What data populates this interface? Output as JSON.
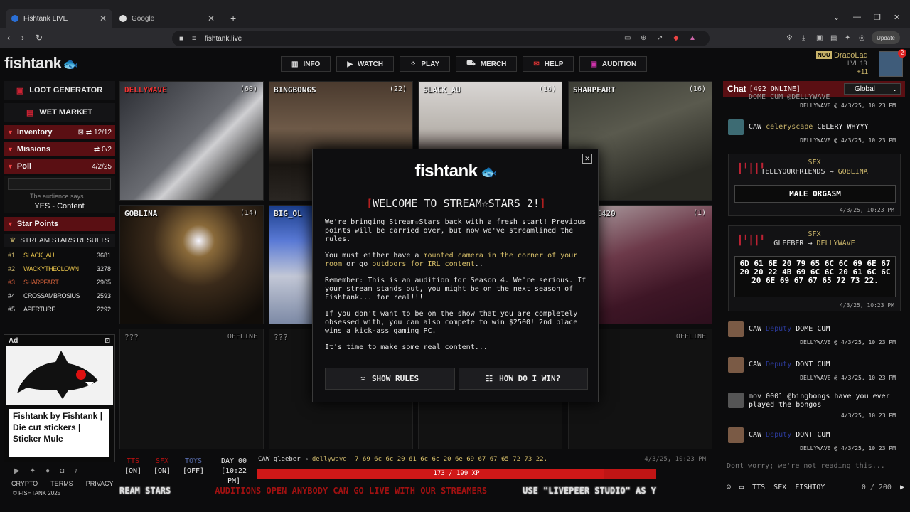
{
  "browser": {
    "tabs": [
      {
        "label": "Fishtank LIVE",
        "active": true
      },
      {
        "label": "Google",
        "active": false
      }
    ],
    "url": "fishtank.live",
    "update_label": "Update"
  },
  "site": {
    "logo": "fishtank",
    "nav": [
      {
        "label": "INFO",
        "icon": "info-icon"
      },
      {
        "label": "WATCH",
        "icon": "watch-icon"
      },
      {
        "label": "PLAY",
        "icon": "dice-icon"
      },
      {
        "label": "MERCH",
        "icon": "merch-icon"
      },
      {
        "label": "HELP",
        "icon": "help-icon"
      },
      {
        "label": "AUDITION",
        "icon": "audition-icon"
      }
    ],
    "user": {
      "badge": "NOU",
      "name": "DracoLad",
      "level": "LVL 13",
      "coins": "+11",
      "notifications": "2"
    }
  },
  "sidebar": {
    "loot_label": "LOOT GENERATOR",
    "market_label": "WET MARKET",
    "inventory": {
      "label": "Inventory",
      "count": "12/12"
    },
    "missions": {
      "label": "Missions",
      "count": "0/2"
    },
    "poll": {
      "label": "Poll",
      "date": "4/2/25",
      "question": "The audience says...",
      "answer": "YES - Content"
    },
    "star_points": {
      "label": "Star Points",
      "results_label": "STREAM STARS RESULTS",
      "rows": [
        {
          "rank": "#1",
          "name": "SLACK_AU",
          "points": "3681"
        },
        {
          "rank": "#2",
          "name": "WACKYTHECLOWN",
          "points": "3278"
        },
        {
          "rank": "#3",
          "name": "SHARPFART",
          "points": "2965"
        },
        {
          "rank": "#4",
          "name": "CROSSAMBROSIUS",
          "points": "2593"
        },
        {
          "rank": "#5",
          "name": "APERTURE",
          "points": "2292"
        }
      ]
    },
    "ad": {
      "label": "Ad",
      "text": "Fishtank by Fishtank | Die cut stickers | Sticker Mule"
    },
    "footer_links": [
      "CRYPTO",
      "TERMS",
      "PRIVACY"
    ],
    "copyright": "© FISHTANK 2025"
  },
  "cams": [
    {
      "name": "DELLYWAVE",
      "count": "(60)",
      "offline": false
    },
    {
      "name": "BINGBONGS",
      "count": "(22)",
      "offline": false
    },
    {
      "name": "SLACK_AU",
      "count": "(16)",
      "offline": false
    },
    {
      "name": "SHARPFART",
      "count": "(16)",
      "offline": false
    },
    {
      "name": "GOBLINA",
      "count": "(14)",
      "offline": false
    },
    {
      "name": "BIG_OL",
      "count": "",
      "offline": false
    },
    {
      "name": "",
      "count": "",
      "offline": false
    },
    {
      "name": "IEBABE420",
      "count": "(1)",
      "offline": false
    },
    {
      "name": "???",
      "count": "OFFLINE",
      "offline": true
    },
    {
      "name": "???",
      "count": "",
      "offline": true
    },
    {
      "name": "",
      "count": "",
      "offline": true
    },
    {
      "name": "",
      "count": "OFFLINE",
      "offline": true
    }
  ],
  "modal": {
    "logo": "fishtank",
    "title": "WELCOME TO STREAM☆STARS 2!",
    "p1": "We're bringing Stream☆Stars back with a fresh start! Previous points will be carried over, but now we've streamlined the rules.",
    "p2_a": "You must either have a ",
    "p2_hl1": "mounted camera in the corner of your room",
    "p2_b": " or go ",
    "p2_hl2": "outdoors for IRL content",
    "p2_c": "..",
    "p3": "Remember: This is an audition for Season 4. We're serious. If your stream stands out, you might be on the next season of Fishtank... for real!!!",
    "p4": "If you don't want to be on the show that you are completely obsessed with, you can also compete to win $2500! 2nd place wins a kick-ass gaming PC.",
    "p5": "It's time to make some real content...",
    "btn_rules": "SHOW RULES",
    "btn_win": "HOW DO I WIN?"
  },
  "bottom": {
    "toggles": [
      {
        "label": "TTS",
        "state": "[ON]",
        "color": "#b11"
      },
      {
        "label": "SFX",
        "state": "[ON]",
        "color": "#b11"
      },
      {
        "label": "TOYS",
        "state": "[OFF]",
        "color": "#5a6fb0"
      }
    ],
    "day": {
      "label": "DAY 00",
      "time": "[10:22 PM]"
    },
    "last_event": {
      "prefix": "CAW",
      "from": "gleeber",
      "to": "dellywave",
      "hex": "7 69 6c 6c 20 61 6c 6c 20 6e 69 67 67 65 72 73 22.",
      "time": "4/3/25, 10:23 PM"
    },
    "xp": {
      "label": "173 / 199 XP",
      "fraction": 0.869
    },
    "ticker_a": "REAM STARS",
    "ticker_b": "AUDITIONS OPEN ANYBODY CAN GO LIVE WITH OUR STREAMERS",
    "ticker_c": "USE \"LIVEPEER STUDIO\" AS Y"
  },
  "chat": {
    "title": "Chat",
    "online": "[492 ONLINE]",
    "channel": "Global",
    "top_partial": "DOME CUM @DELLYWAVE",
    "top_meta": "DELLYWAVE @ 4/3/25, 10:23 PM",
    "m1": {
      "prefix": "CAW",
      "user": "celeryscape",
      "text": "CELERY WHYYY",
      "meta": "DELLYWAVE @ 4/3/25, 10:23 PM"
    },
    "sfx1": {
      "label": "SFX",
      "from": "TELLYOURFRIENDS",
      "to": "GOBLINA",
      "box": "MALE ORGASM",
      "meta": "4/3/25, 10:23 PM"
    },
    "sfx2": {
      "label": "SFX",
      "from": "GLEEBER",
      "to": "DELLYWAVE",
      "box": "6D 61 6E 20 79 65 6C 6C 69 6E 67 20 20 22 4B 69 6C 6C 20 61 6C 6C 20 6E 69 67 67 65 72 73 22.",
      "meta": "4/3/25, 10:23 PM"
    },
    "m2": {
      "prefix": "CAW",
      "user": "Deputy",
      "text": "DOME CUM",
      "meta": "DELLYWAVE @ 4/3/25, 10:23 PM"
    },
    "m3": {
      "prefix": "CAW",
      "user": "Deputy",
      "text": "DONT CUM",
      "meta": "DELLYWAVE @ 4/3/25, 10:23 PM"
    },
    "m4": {
      "user": "mov_0001",
      "line1": "@bingbongs have you ever",
      "line2": "played the bongos",
      "meta": "4/3/25, 10:23 PM"
    },
    "m5": {
      "prefix": "CAW",
      "user": "Deputy",
      "text": "DONT CUM",
      "meta": "DELLYWAVE @ 4/3/25, 10:23 PM"
    },
    "input_placeholder": "Dont worry; we're not reading this...",
    "controls": {
      "tts": "TTS",
      "sfx": "SFX",
      "fishtoy": "FISHTOY",
      "count": "0 / 200"
    }
  },
  "colors": {
    "accent_red": "#5a0f13",
    "gold": "#c9b46a",
    "bg": "#0c0c0d"
  }
}
